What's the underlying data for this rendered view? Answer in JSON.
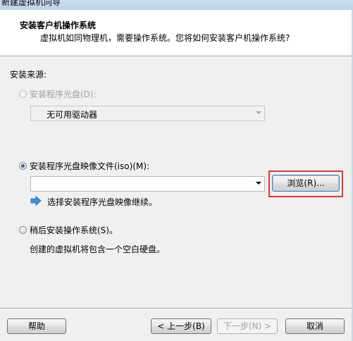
{
  "window": {
    "title": "新建虚拟机向导"
  },
  "header": {
    "title": "安装客户机操作系统",
    "subtitle": "虚拟机如同物理机，需要操作系统。您将如何安装客户机操作系统?"
  },
  "install_source": {
    "label": "安装来源:",
    "disc_option": {
      "label": "安装程序光盘(D):",
      "selected": false,
      "enabled": false
    },
    "disc_dropdown": {
      "value": "无可用驱动器"
    },
    "iso_option": {
      "label": "安装程序光盘映像文件(iso)(M):",
      "selected": true,
      "enabled": true
    },
    "iso_path": {
      "value": ""
    },
    "browse_button": "浏览(R)...",
    "iso_hint": "选择安装程序光盘映像继续。",
    "later_option": {
      "label": "稍后安装操作系统(S)。",
      "selected": false,
      "enabled": true
    },
    "later_hint": "创建的虚拟机将包含一个空白硬盘。"
  },
  "footer": {
    "help_button": "帮助",
    "back_button": "< 上一步(B)",
    "next_button": "下一步(N) >",
    "cancel_button": "取消"
  },
  "colors": {
    "accent": "#2a62a8",
    "highlight": "#e03838",
    "info_arrow": "#3b8fd6"
  }
}
